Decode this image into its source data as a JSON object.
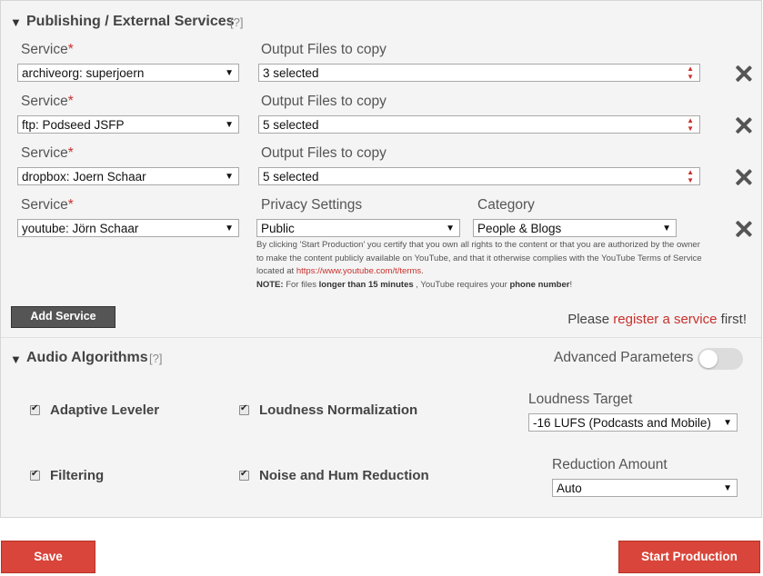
{
  "publishing": {
    "title": "Publishing / External Services",
    "help": "[?]",
    "required_mark": "*",
    "services": [
      {
        "service_label": "Service",
        "service_value": "archiveorg: superjoern",
        "files_label": "Output Files to copy",
        "files_value": "3 selected"
      },
      {
        "service_label": "Service",
        "service_value": "ftp: Podseed JSFP",
        "files_label": "Output Files to copy",
        "files_value": "5 selected"
      },
      {
        "service_label": "Service",
        "service_value": "dropbox: Joern Schaar",
        "files_label": "Output Files to copy",
        "files_value": "5 selected"
      }
    ],
    "youtube": {
      "service_label": "Service",
      "service_value": "youtube: Jörn Schaar",
      "privacy_label": "Privacy Settings",
      "privacy_value": "Public",
      "category_label": "Category",
      "category_value": "People & Blogs",
      "disclaimer_1": "By clicking 'Start Production' you certify that you own all rights to the content or that you are authorized by the owner to make the content publicly available on YouTube, and that it otherwise complies with the YouTube Terms of Service located at",
      "disclaimer_link": "https://www.youtube.com/t/terms",
      "disclaimer_end": ".",
      "note_label": "NOTE:",
      "note_text_1": "For files",
      "note_bold_1": "longer than 15 minutes",
      "note_text_2": ", YouTube requires your",
      "note_bold_2": "phone number",
      "note_text_3": "!"
    },
    "add_service_label": "Add Service",
    "register_prefix": "Please",
    "register_link": "register a service",
    "register_suffix": "first!"
  },
  "audio": {
    "title": "Audio Algorithms",
    "help": "[?]",
    "advanced_label": "Advanced Parameters",
    "advanced_enabled": false,
    "adaptive_leveler": "Adaptive Leveler",
    "loudness_normalization": "Loudness Normalization",
    "loudness_target_label": "Loudness Target",
    "loudness_target_value": "-16 LUFS (Podcasts and Mobile)",
    "filtering": "Filtering",
    "noise_reduction": "Noise and Hum Reduction",
    "reduction_amount_label": "Reduction Amount",
    "reduction_amount_value": "Auto"
  },
  "footer": {
    "save_label": "Save",
    "start_label": "Start Production"
  },
  "icons": {
    "collapse": "triangle-down-icon",
    "remove": "close-icon",
    "checkbox": "check-icon"
  },
  "colors": {
    "accent": "#c9302c",
    "button_red": "#d9453a",
    "button_dark": "#555555",
    "panel_bg": "#f4f4f4"
  }
}
